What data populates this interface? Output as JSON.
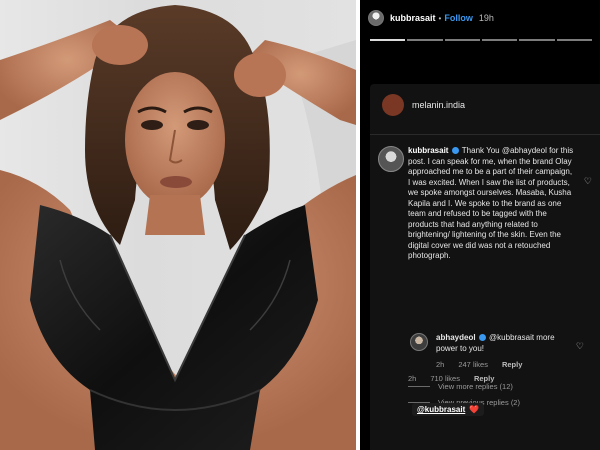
{
  "story": {
    "header": {
      "username": "kubbrasait",
      "follow_label": "Follow",
      "time": "19h"
    },
    "progress_segments": 6,
    "shared_post": {
      "brand_name": "melanin.india",
      "comment": {
        "username": "kubbrasait",
        "text": "Thank You @abhaydeol for this post. I can speak for me, when the brand Olay approached me to be a part of their campaign, I was excited. When I saw the list of products, we spoke amongst ourselves. Masaba, Kusha Kapila and I. We spoke to the brand as one team and refused to be tagged with the products that had anything related to brightening/ lightening of the skin. Even the digital cover we did was not a retouched photograph.",
        "age": "2h",
        "likes": "710 likes",
        "reply_label": "Reply"
      },
      "view_previous": "View previous replies (2)",
      "reply": {
        "username": "abhaydeol",
        "text": "@kubbrasait more power to you!",
        "age": "2h",
        "likes": "247 likes",
        "reply_label": "Reply"
      },
      "view_more": "View more replies (12)"
    },
    "mention": {
      "tag": "@kubbrasait",
      "emoji": "❤️"
    },
    "colors": {
      "follow": "#3b98f1",
      "verified": "#3b98f1",
      "brand_avatar": "#7a3724",
      "heart": "#e0263a"
    }
  },
  "icons": {
    "comment_like": "heart-outline-icon",
    "verified": "verified-badge-icon"
  }
}
